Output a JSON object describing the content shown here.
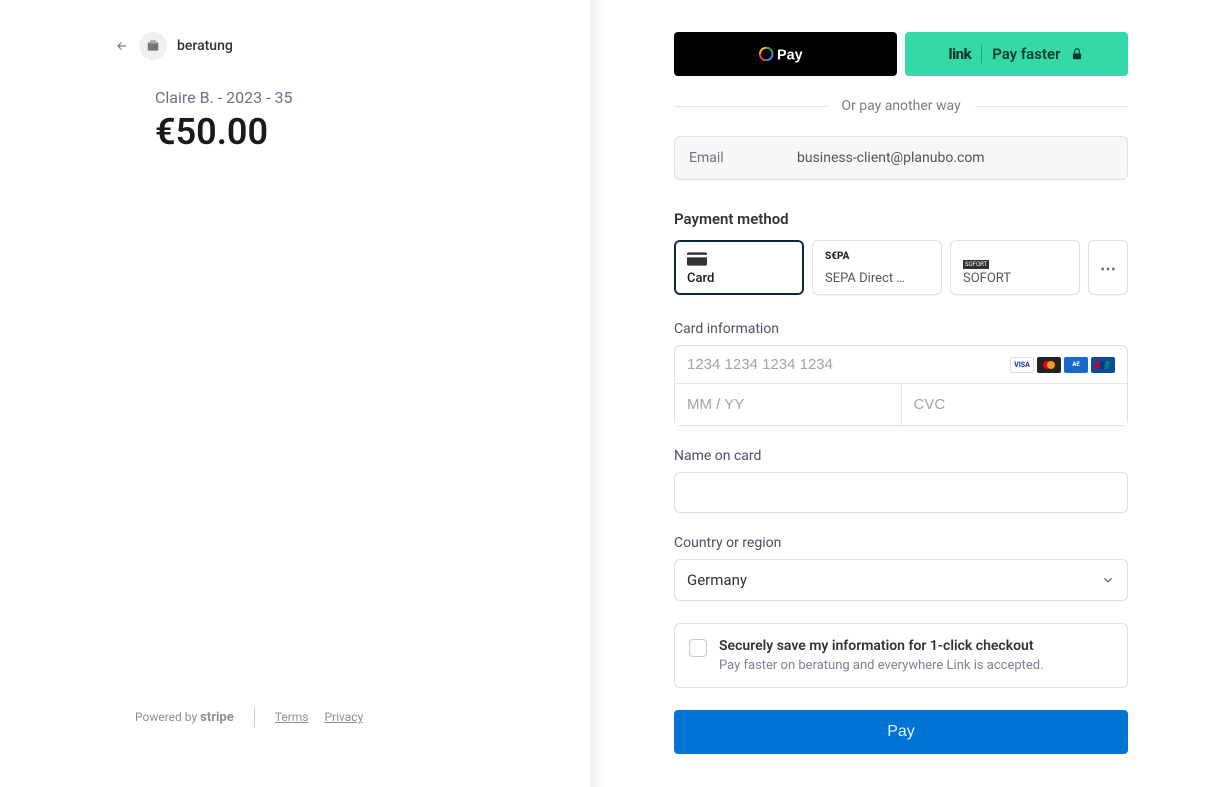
{
  "merchant": {
    "name": "beratung"
  },
  "product": {
    "description": "Claire B. - 2023 - 35",
    "price": "€50.00"
  },
  "footer": {
    "powered_by": "Powered by",
    "brand": "stripe",
    "terms": "Terms",
    "privacy": "Privacy"
  },
  "express": {
    "gpay_alt": "Pay",
    "link_logo": "link",
    "link_label": "Pay faster"
  },
  "divider_text": "Or pay another way",
  "email": {
    "label": "Email",
    "value": "business-client@planubo.com"
  },
  "payment_method": {
    "title": "Payment method",
    "tabs": [
      {
        "label": "Card"
      },
      {
        "brand": "S€PA",
        "label": "SEPA Direct …"
      },
      {
        "brand": "SOFORT",
        "label": "SOFORT"
      }
    ]
  },
  "card_section": {
    "title": "Card information",
    "number_placeholder": "1234 1234 1234 1234",
    "expiry_placeholder": "MM / YY",
    "cvc_placeholder": "CVC"
  },
  "name_section": {
    "title": "Name on card"
  },
  "country_section": {
    "title": "Country or region",
    "value": "Germany"
  },
  "save_section": {
    "title": "Securely save my information for 1-click checkout",
    "subtitle": "Pay faster on beratung and everywhere Link is accepted."
  },
  "pay_button": "Pay"
}
